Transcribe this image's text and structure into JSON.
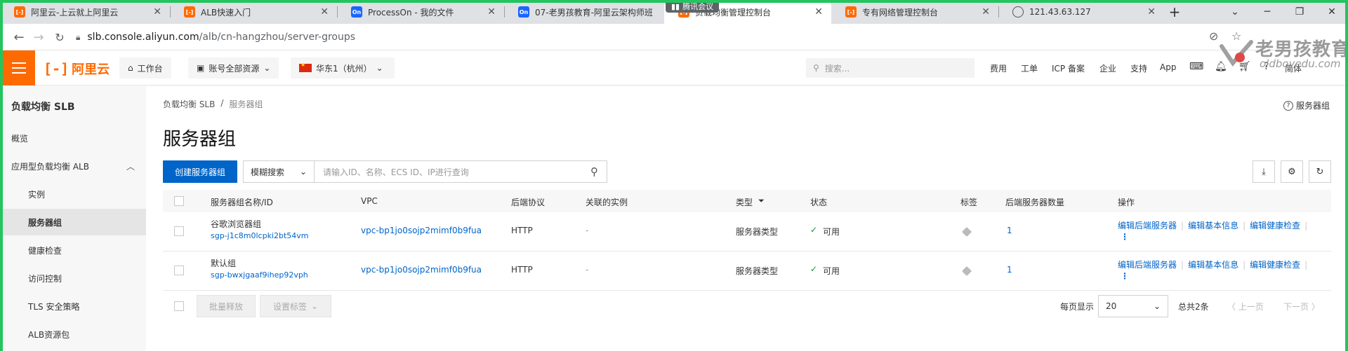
{
  "browser": {
    "tabs": [
      {
        "title": "阿里云-上云就上阿里云",
        "favicon": "aliyun-icon"
      },
      {
        "title": "ALB快速入门",
        "favicon": "aliyun-icon"
      },
      {
        "title": "ProcessOn - 我的文件",
        "favicon": "processon-icon"
      },
      {
        "title": "07-老男孩教育-阿里云架构师班",
        "favicon": "processon-icon"
      },
      {
        "title": "负载均衡管理控制台",
        "favicon": "aliyun-icon"
      },
      {
        "title": "专有网络管理控制台",
        "favicon": "aliyun-icon"
      },
      {
        "title": "121.43.63.127",
        "favicon": "globe-icon"
      }
    ],
    "new_tab": "+",
    "meeting_badge": "腾讯会议",
    "address": {
      "host": "slb.console.aliyun.com",
      "path": "/alb/cn-hangzhou/server-groups"
    }
  },
  "watermark": {
    "name": "老男孩教育",
    "domain": "oldboyedu.com"
  },
  "topnav": {
    "logo_text": "阿里云",
    "workbench": "工作台",
    "account_scope": "账号全部资源",
    "region": "华东1（杭州）",
    "search_placeholder": "搜索...",
    "links": [
      "费用",
      "工单",
      "ICP 备案",
      "企业",
      "支持",
      "App"
    ],
    "lang": "简体"
  },
  "sidebar": {
    "title": "负载均衡 SLB",
    "items": [
      {
        "label": "概览",
        "level": 1
      },
      {
        "label": "应用型负载均衡 ALB",
        "level": 1,
        "expanded": true
      },
      {
        "label": "实例",
        "level": 2
      },
      {
        "label": "服务器组",
        "level": 2,
        "active": true
      },
      {
        "label": "健康检查",
        "level": 2
      },
      {
        "label": "访问控制",
        "level": 2
      },
      {
        "label": "TLS 安全策略",
        "level": 2
      },
      {
        "label": "ALB资源包",
        "level": 2
      }
    ]
  },
  "main": {
    "breadcrumb": [
      "负载均衡 SLB",
      "服务器组"
    ],
    "breadcrumb_sep": "/",
    "help_link": "服务器组",
    "title": "服务器组",
    "create_button": "创建服务器组",
    "search_mode": "模糊搜索",
    "search_placeholder": "请输入ID、名称、ECS ID、IP进行查询",
    "table": {
      "headers": {
        "name": "服务器组名称/ID",
        "vpc": "VPC",
        "protocol": "后端协议",
        "instances": "关联的实例",
        "type": "类型",
        "status": "状态",
        "tags": "标签",
        "backend_count": "后端服务器数量",
        "actions": "操作"
      },
      "rows": [
        {
          "name": "谷歌浏览器组",
          "id": "sgp-j1c8m0lcpki2bt54vm",
          "vpc": "vpc-bp1jo0sojp2mimf0b9fua",
          "protocol": "HTTP",
          "instances": "-",
          "type": "服务器类型",
          "status": "可用",
          "backend_count": "1"
        },
        {
          "name": "默认组",
          "id": "sgp-bwxjgaaf9ihep92vph",
          "vpc": "vpc-bp1jo0sojp2mimf0b9fua",
          "protocol": "HTTP",
          "instances": "-",
          "type": "服务器类型",
          "status": "可用",
          "backend_count": "1"
        }
      ],
      "row_actions": [
        "编辑后端服务器",
        "编辑基本信息",
        "编辑健康检查"
      ]
    },
    "footer": {
      "batch_release": "批量释放",
      "set_tags": "设置标签",
      "per_page_label": "每页显示",
      "per_page_value": "20",
      "total": "总共2条",
      "prev": "上一页",
      "next": "下一页"
    }
  },
  "colors": {
    "brand": "#ff6a00",
    "primary": "#0064c8",
    "frame": "#22c55e",
    "status_ok": "#1e8e3e"
  }
}
